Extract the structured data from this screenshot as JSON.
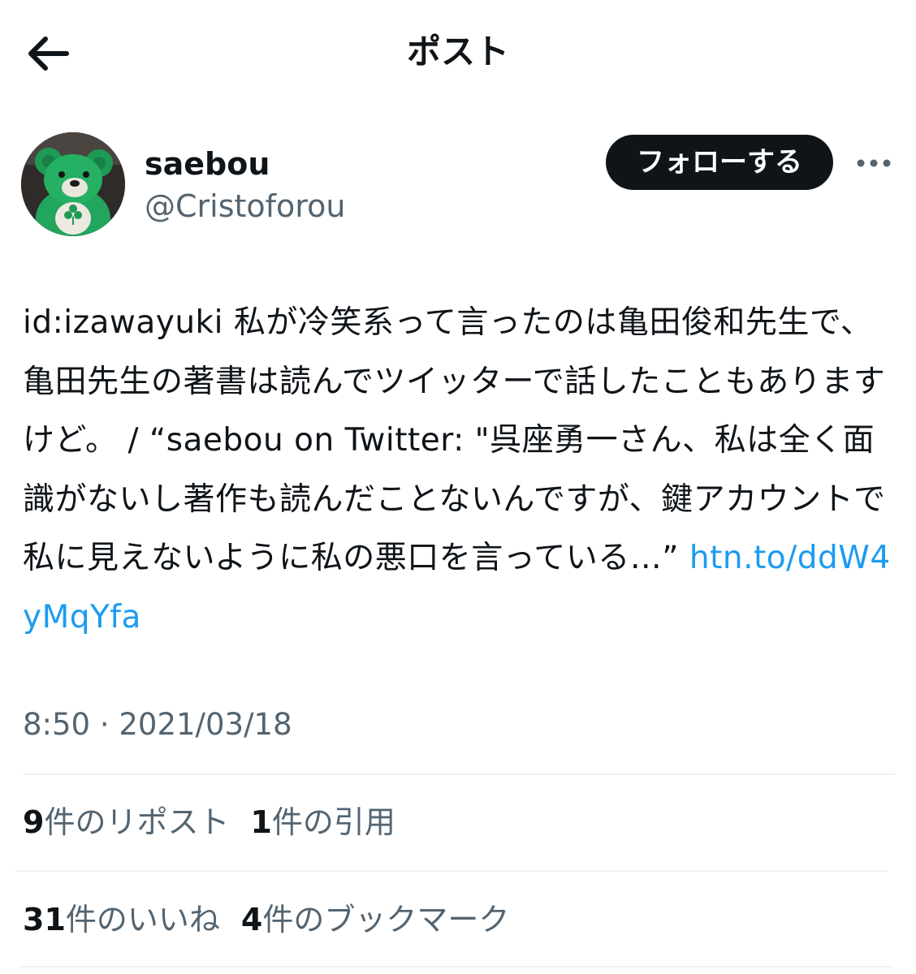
{
  "header": {
    "title": "ポスト",
    "back_icon": "arrow-left-icon"
  },
  "author": {
    "display_name": "saebou",
    "handle": "@Cristoforou",
    "avatar_icon": "green-teddy-bear-avatar"
  },
  "actions": {
    "follow_label": "フォローする",
    "more_icon": "more-dots-icon"
  },
  "post": {
    "text": "id:izawayuki 私が冷笑系って言ったのは亀田俊和先生で、亀田先生の著書は読んでツイッターで話したこともありますけど。 / “saebou on Twitter: \"呉座勇一さん、私は全く面識がないし著作も読んだことないんですが、鍵アカウントで私に見えないように私の悪口を言っている…” ",
    "link": "htn.to/ddW4yMqYfa",
    "timestamp": "8:50 · 2021/03/18"
  },
  "stats": {
    "reposts": {
      "count": "9",
      "label": "件のリポスト"
    },
    "quotes": {
      "count": "1",
      "label": "件の引用"
    },
    "likes": {
      "count": "31",
      "label": "件のいいね"
    },
    "bookmarks": {
      "count": "4",
      "label": "件のブックマーク"
    }
  },
  "colors": {
    "text": "#0f1419",
    "secondary": "#536471",
    "link": "#1d9bf0",
    "divider": "#eff3f4",
    "button_bg": "#0f1419"
  }
}
